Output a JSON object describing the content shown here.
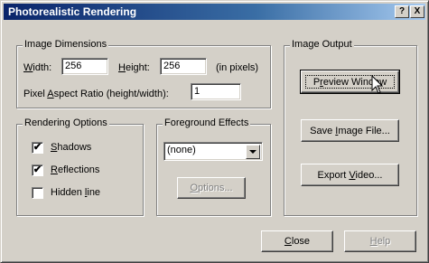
{
  "window": {
    "title": "Photorealistic Rendering",
    "help_btn": "?",
    "close_btn": "X"
  },
  "image_dimensions": {
    "legend": "Image Dimensions",
    "width_label_u": "W",
    "width_label_rest": "idth:",
    "width_value": "256",
    "height_label_u": "H",
    "height_label_rest": "eight:",
    "height_value": "256",
    "units": "(in pixels)",
    "aspect_label_pre": "Pixel ",
    "aspect_label_u": "A",
    "aspect_label_post": "spect Ratio (height/width):",
    "aspect_value": "1"
  },
  "rendering_options": {
    "legend": "Rendering Options",
    "items": [
      {
        "u": "S",
        "rest": "hadows",
        "checked": true,
        "mark": "✔"
      },
      {
        "u": "R",
        "rest": "eflections",
        "checked": true,
        "mark": "✔"
      },
      {
        "pre": "Hidden ",
        "u": "l",
        "rest": "ine",
        "checked": false,
        "mark": ""
      }
    ]
  },
  "foreground_effects": {
    "legend": "Foreground Effects",
    "selected": "(none)",
    "options_btn_u": "O",
    "options_btn_rest": "ptions..."
  },
  "image_output": {
    "legend": "Image Output",
    "preview_pre": "P",
    "preview_u": "r",
    "preview_post": "eview Window",
    "save_pre": "Save ",
    "save_u": "I",
    "save_post": "mage File...",
    "export_pre": "Export ",
    "export_u": "V",
    "export_post": "ideo..."
  },
  "footer": {
    "close_u": "C",
    "close_rest": "lose",
    "help_u": "H",
    "help_rest": "elp"
  }
}
